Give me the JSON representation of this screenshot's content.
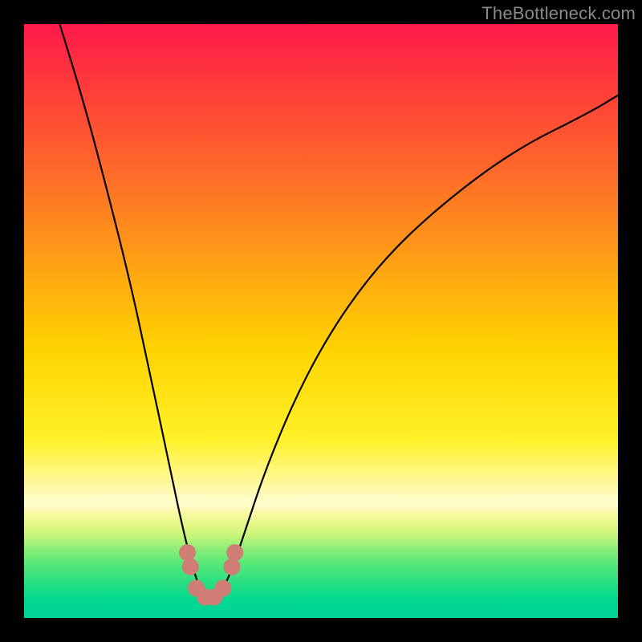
{
  "watermark": "TheBottleneck.com",
  "chart_data": {
    "type": "line",
    "title": "",
    "xlabel": "",
    "ylabel": "",
    "xlim": [
      0,
      100
    ],
    "ylim": [
      0,
      100
    ],
    "series": [
      {
        "name": "curve",
        "x": [
          6,
          10,
          14,
          18,
          21,
          24,
          26.5,
          28.5,
          30,
          31.5,
          33,
          35,
          37,
          41,
          47,
          54,
          62,
          72,
          83,
          95,
          100
        ],
        "values": [
          100,
          87,
          72,
          56,
          42,
          28,
          16,
          8,
          4,
          3,
          4,
          8,
          14,
          26,
          40,
          52,
          62,
          71,
          79,
          85,
          88
        ]
      }
    ],
    "markers": {
      "name": "bottom-dots",
      "color": "#d07d75",
      "points": [
        {
          "x": 27.5,
          "y": 11.0
        },
        {
          "x": 28.0,
          "y": 8.6
        },
        {
          "x": 29.0,
          "y": 5.0
        },
        {
          "x": 30.5,
          "y": 3.5
        },
        {
          "x": 32.0,
          "y": 3.5
        },
        {
          "x": 33.5,
          "y": 5.0
        },
        {
          "x": 35.0,
          "y": 8.6
        },
        {
          "x": 35.5,
          "y": 11.0
        }
      ]
    },
    "background_gradient": {
      "top": "#ff1a4b",
      "mid": "#fff12a",
      "bottom": "#00d39a"
    }
  }
}
